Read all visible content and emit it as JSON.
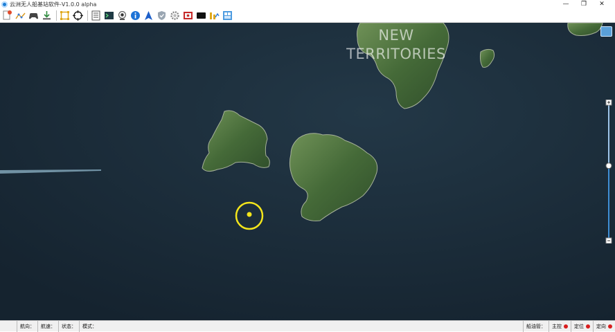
{
  "window": {
    "title": "云洲无人船基站软件-V1.0.0 alpha",
    "minimize_glyph": "—",
    "restore_glyph": "❐",
    "close_glyph": "✕"
  },
  "toolbar": {
    "buttons": [
      {
        "name": "new-mission-icon"
      },
      {
        "name": "waypoint-tool-icon"
      },
      {
        "name": "gamepad-icon"
      },
      {
        "name": "download-icon"
      },
      {
        "name": "fit-bounds-icon"
      },
      {
        "name": "crosshair-icon"
      },
      {
        "name": "log-list-icon"
      },
      {
        "name": "terminal-icon"
      },
      {
        "name": "camera-icon"
      },
      {
        "name": "info-icon"
      },
      {
        "name": "navigation-arrow-icon"
      },
      {
        "name": "shield-icon"
      },
      {
        "name": "settings-gear-icon"
      },
      {
        "name": "video-icon"
      },
      {
        "name": "monitor-icon"
      },
      {
        "name": "chart-tool-icon"
      },
      {
        "name": "window-layout-icon"
      }
    ]
  },
  "map": {
    "label_line1": "NEW",
    "label_line2": "TERRITORIES",
    "colors": {
      "sea": "#1c2d3a",
      "land": "#4e7440",
      "marker": "#f3e51b",
      "slider": "#3f8fd6"
    },
    "zoom_level_fraction": 0.4
  },
  "status": {
    "heading_label": "航向：",
    "speed_label": "航速：",
    "state_label": "状态：",
    "mode_label": "模式：",
    "ship_control_label": "船油管：",
    "main_control_label": "主控",
    "positioning_label": "定位",
    "direction_label": "定向"
  }
}
